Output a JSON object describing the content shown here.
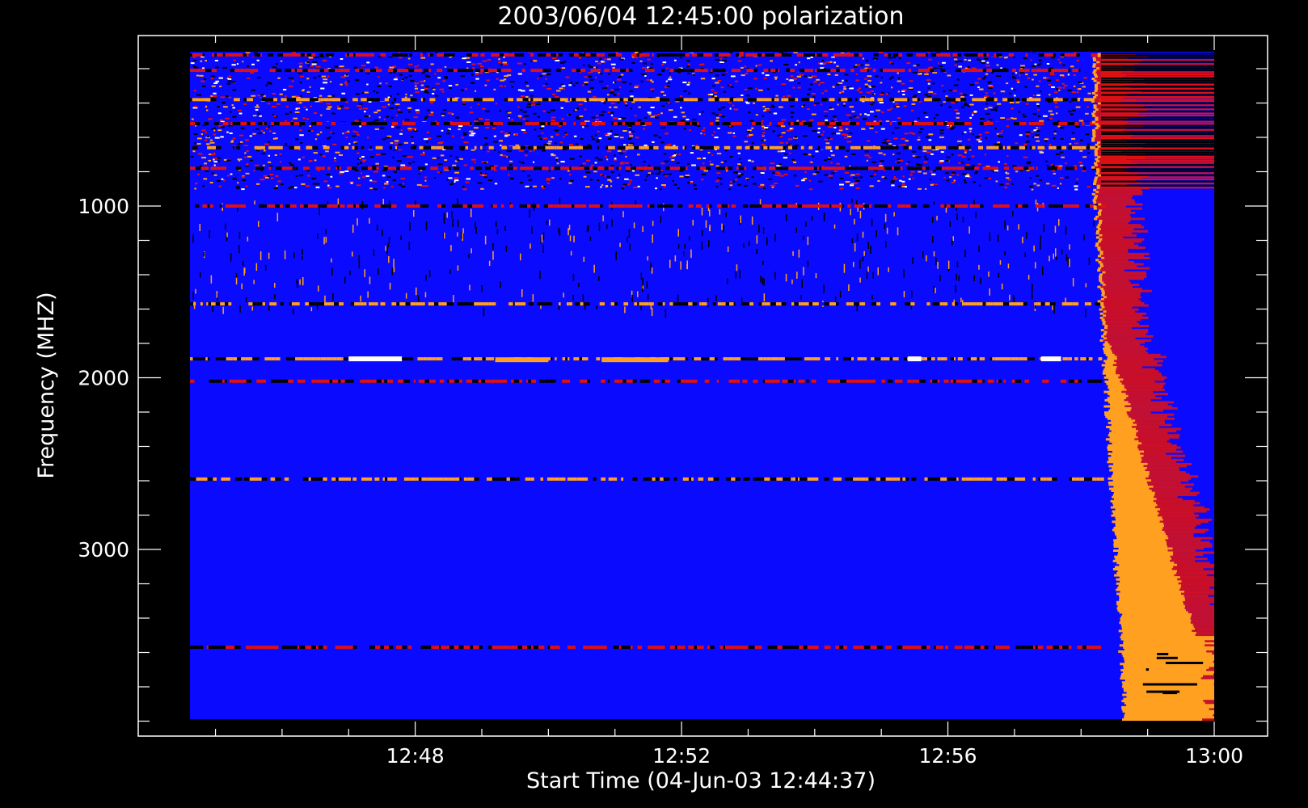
{
  "chart_data": {
    "type": "heatmap",
    "title": "2003/06/04 12:45:00 polarization",
    "xlabel": "Start Time (04-Jun-03 12:44:37)",
    "ylabel": "Frequency (MHZ)",
    "x_tick_labels": [
      "12:48",
      "12:52",
      "12:56",
      "13:00"
    ],
    "x_tick_minutes": [
      48,
      52,
      56,
      60
    ],
    "y_tick_labels": [
      "1000",
      "2000",
      "3000"
    ],
    "y_tick_values": [
      1000,
      2000,
      3000
    ],
    "xlim_minutes": [
      44.617,
      60.0
    ],
    "ylim": [
      4200,
      0
    ],
    "grid": false,
    "colors": {
      "background": "#000000",
      "frame": "#ffffff",
      "baseline": "#0a0aff",
      "positive_burst": "#ffa020",
      "red": "#e01010",
      "white": "#ffffff"
    },
    "bands": [
      {
        "freq": 120,
        "color": "#e01010"
      },
      {
        "freq": 210,
        "color": "#e01010"
      },
      {
        "freq": 380,
        "color": "#ffa020"
      },
      {
        "freq": 520,
        "color": "#e01010"
      },
      {
        "freq": 660,
        "color": "#ffa020"
      },
      {
        "freq": 780,
        "color": "#e01010"
      },
      {
        "freq": 1000,
        "color": "#e01010"
      },
      {
        "freq": 1570,
        "color": "#ffa020"
      },
      {
        "freq": 1890,
        "color": "#ffa020"
      },
      {
        "freq": 2020,
        "color": "#e01010"
      },
      {
        "freq": 2590,
        "color": "#ffa020"
      },
      {
        "freq": 3570,
        "color": "#e01010"
      }
    ],
    "burst": {
      "start_minute": 58.2,
      "color": "#ffa020",
      "edge_color": "#e01010"
    }
  }
}
